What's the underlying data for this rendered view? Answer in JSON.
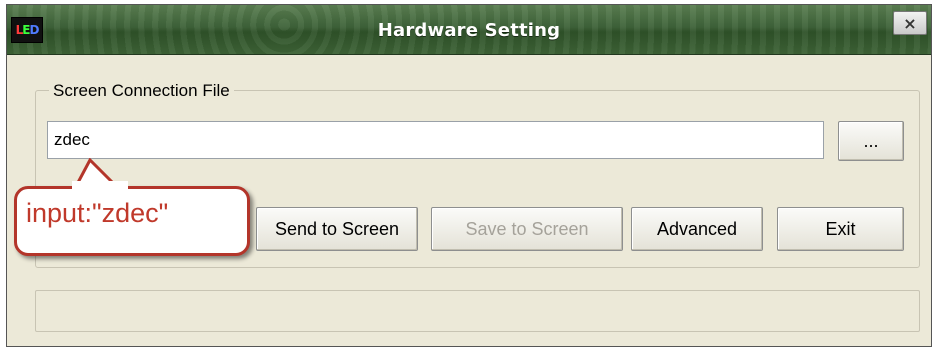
{
  "window": {
    "title": "Hardware Setting",
    "logo_letters": [
      "L",
      "E",
      "D"
    ],
    "close_symbol": "×"
  },
  "group": {
    "label": "Screen Connection File"
  },
  "file_input": {
    "value": "zdec"
  },
  "buttons": {
    "browse": "...",
    "send": "Send to Screen",
    "save": "Save to Screen",
    "advanced": "Advanced",
    "exit": "Exit"
  },
  "annotation": {
    "text": "input:\"zdec\"",
    "color": "#c0392b"
  },
  "status_bar": {
    "text": ""
  }
}
